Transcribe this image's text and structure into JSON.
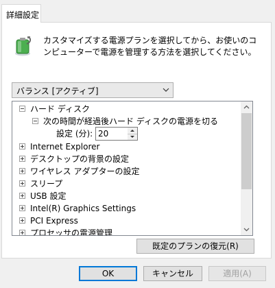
{
  "tab": {
    "label": "詳細設定"
  },
  "header": {
    "description": "カスタマイズする電源プランを選択してから、お使いのコンピューターで電源を管理する方法を選択してください。"
  },
  "plan_select": {
    "value": "バランス [アクティブ]"
  },
  "tree": {
    "hard_disk": {
      "label": "ハード ディスク",
      "child_label": "次の時間が経過後ハード ディスクの電源を切る",
      "setting_label": "設定 (分):",
      "setting_value": "20"
    },
    "items": [
      {
        "label": "Internet Explorer"
      },
      {
        "label": "デスクトップの背景の設定"
      },
      {
        "label": "ワイヤレス アダプターの設定"
      },
      {
        "label": "スリープ"
      },
      {
        "label": "USB 設定"
      },
      {
        "label": "Intel(R) Graphics Settings"
      },
      {
        "label": "PCI Express"
      },
      {
        "label": "プロセッサの電源管理"
      }
    ]
  },
  "buttons": {
    "restore": "既定のプランの復元(R)",
    "ok": "OK",
    "cancel": "キャンセル",
    "apply": "適用(A)"
  }
}
